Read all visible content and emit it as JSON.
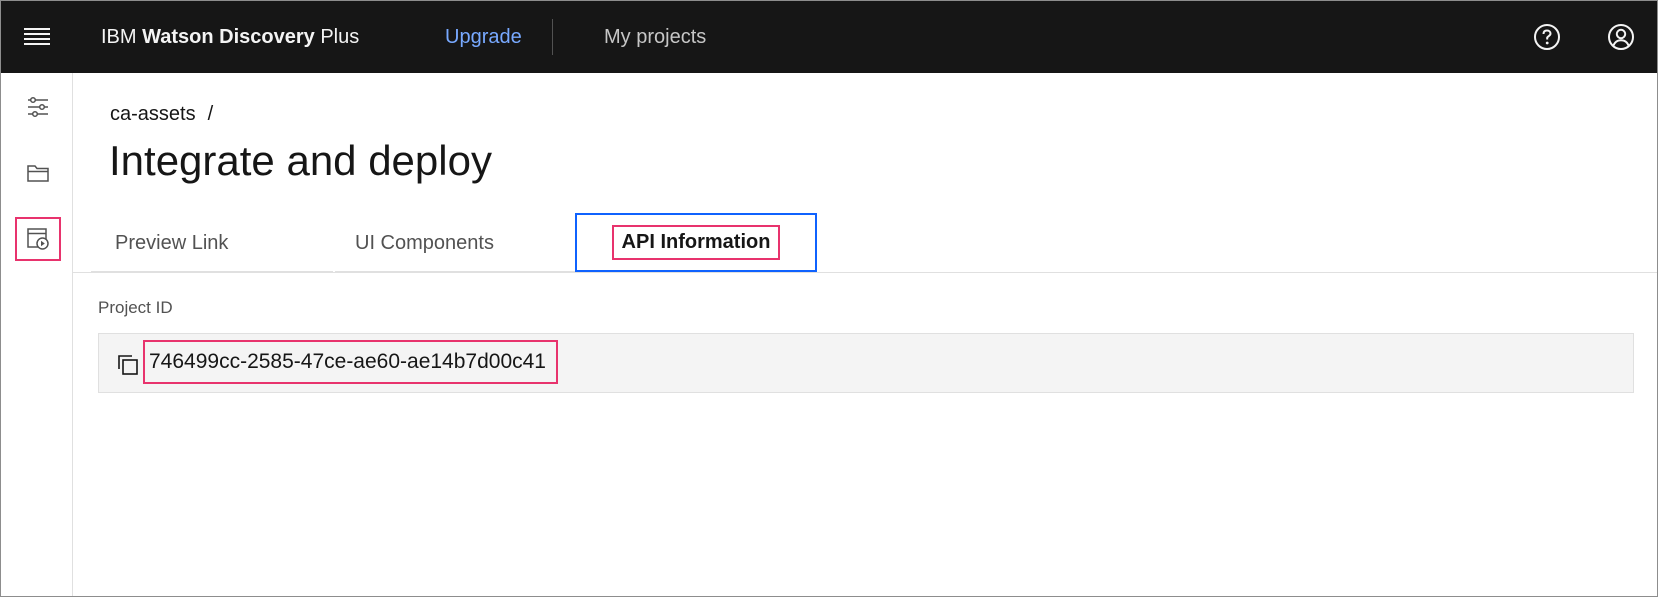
{
  "header": {
    "brand_prefix": "IBM",
    "brand_product": "Watson Discovery",
    "brand_suffix": "Plus",
    "upgrade_label": "Upgrade",
    "projects_label": "My projects"
  },
  "breadcrumb": {
    "project": "ca-assets",
    "separator": "/"
  },
  "page": {
    "title": "Integrate and deploy"
  },
  "tabs": [
    {
      "label": "Preview Link",
      "selected": false
    },
    {
      "label": "UI Components",
      "selected": false
    },
    {
      "label": "API Information",
      "selected": true
    }
  ],
  "project_id": {
    "label": "Project ID",
    "value": "746499cc-2585-47ce-ae60-ae14b7d00c41"
  },
  "rail": {
    "items": [
      {
        "icon": "settings-adjust-icon"
      },
      {
        "icon": "folder-icon"
      },
      {
        "icon": "deploy-icon",
        "highlighted": true
      }
    ]
  },
  "colors": {
    "header_bg": "#161616",
    "accent_link": "#78a9ff",
    "focus_blue": "#0f62fe",
    "highlight_pink": "#e8336d"
  }
}
